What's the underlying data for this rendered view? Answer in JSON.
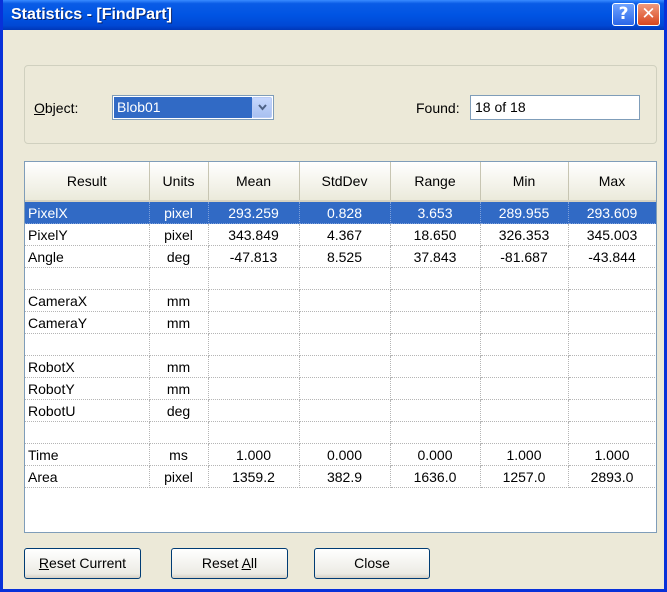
{
  "window": {
    "title": "Statistics - [FindPart]",
    "help_glyph": "?",
    "close_glyph": "✕"
  },
  "object": {
    "label_prefix": "O",
    "label_rest": "bject:",
    "value": "Blob01"
  },
  "found": {
    "label": "Found:",
    "value": "18 of 18"
  },
  "table": {
    "columns": [
      "Result",
      "Units",
      "Mean",
      "StdDev",
      "Range",
      "Min",
      "Max"
    ],
    "rows": [
      [
        "PixelX",
        "pixel",
        "293.259",
        "0.828",
        "3.653",
        "289.955",
        "293.609"
      ],
      [
        "PixelY",
        "pixel",
        "343.849",
        "4.367",
        "18.650",
        "326.353",
        "345.003"
      ],
      [
        "Angle",
        "deg",
        "-47.813",
        "8.525",
        "37.843",
        "-81.687",
        "-43.844"
      ],
      [
        "",
        "",
        "",
        "",
        "",
        "",
        ""
      ],
      [
        "CameraX",
        "mm",
        "",
        "",
        "",
        "",
        ""
      ],
      [
        "CameraY",
        "mm",
        "",
        "",
        "",
        "",
        ""
      ],
      [
        "",
        "",
        "",
        "",
        "",
        "",
        ""
      ],
      [
        "RobotX",
        "mm",
        "",
        "",
        "",
        "",
        ""
      ],
      [
        "RobotY",
        "mm",
        "",
        "",
        "",
        "",
        ""
      ],
      [
        "RobotU",
        "deg",
        "",
        "",
        "",
        "",
        ""
      ],
      [
        "",
        "",
        "",
        "",
        "",
        "",
        ""
      ],
      [
        "Time",
        "ms",
        "1.000",
        "0.000",
        "0.000",
        "1.000",
        "1.000"
      ],
      [
        "Area",
        "pixel",
        "1359.2",
        "382.9",
        "1636.0",
        "1257.0",
        "2893.0"
      ]
    ],
    "selected_row": "PixelX"
  },
  "buttons": {
    "reset_current_mnemonic": "R",
    "reset_current_rest": "eset Current",
    "reset_all_prefix": "Reset ",
    "reset_all_mnemonic": "A",
    "reset_all_rest": "ll",
    "close": "Close"
  },
  "colors": {
    "titlebar": "#0054E3",
    "selection": "#316AC5",
    "dialog_bg": "#ECE9D8"
  }
}
